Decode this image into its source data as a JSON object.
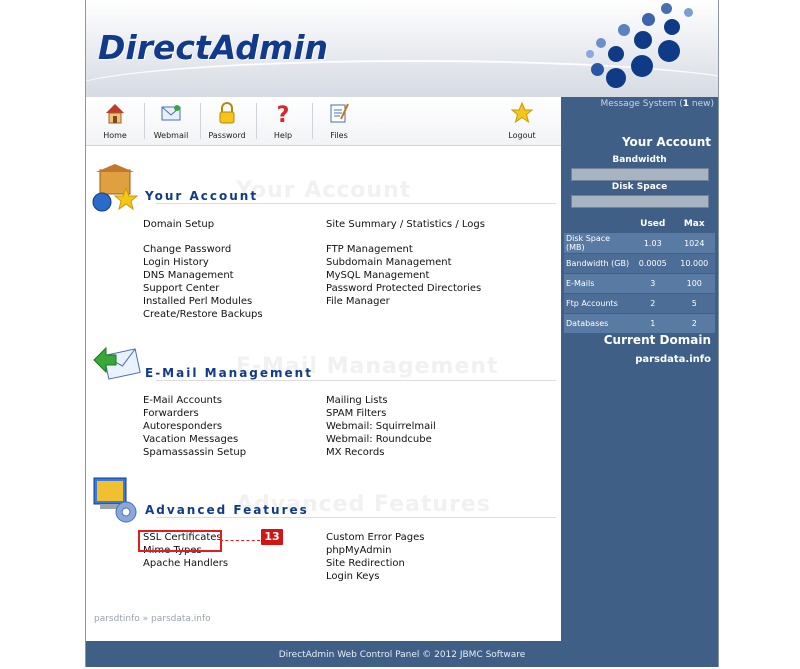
{
  "header": {
    "logo_text": "DirectAdmin"
  },
  "toolbar": {
    "items": [
      {
        "label": "Home",
        "icon": "home-icon"
      },
      {
        "label": "Webmail",
        "icon": "webmail-icon"
      },
      {
        "label": "Password",
        "icon": "lock-icon"
      },
      {
        "label": "Help",
        "icon": "question-icon"
      },
      {
        "label": "Files",
        "icon": "files-icon"
      },
      {
        "label": "Logout",
        "icon": "star-icon"
      }
    ]
  },
  "sidebar": {
    "message_prefix": "Message System (",
    "message_count": "1",
    "message_suffix": " new)",
    "your_account_title": "Your Account",
    "bandwidth_label": "Bandwidth",
    "diskspace_label": "Disk Space",
    "stats_headers": {
      "used": "Used",
      "max": "Max"
    },
    "stats": [
      {
        "name": "Disk Space (MB)",
        "used": "1.03",
        "max": "1024"
      },
      {
        "name": "Bandwidth (GB)",
        "used": "0.0005",
        "max": "10.000"
      },
      {
        "name": "E-Mails",
        "used": "3",
        "max": "100"
      },
      {
        "name": "Ftp Accounts",
        "used": "2",
        "max": "5"
      },
      {
        "name": "Databases",
        "used": "1",
        "max": "2"
      }
    ],
    "current_domain_title": "Current Domain",
    "current_domain": "parsdata.info"
  },
  "sections": {
    "account": {
      "title": "Your Account",
      "ghost": "Your Account",
      "left": [
        "Domain Setup",
        "",
        "Change Password",
        "Login History",
        "DNS Management",
        "Support Center",
        "Installed Perl Modules",
        "Create/Restore Backups"
      ],
      "right": [
        "Site Summary / Statistics / Logs",
        "",
        "FTP Management",
        "Subdomain Management",
        "MySQL Management",
        "Password Protected Directories",
        "File Manager"
      ]
    },
    "email": {
      "title": "E-Mail Management",
      "ghost": "E-Mail Management",
      "left": [
        "E-Mail Accounts",
        "Forwarders",
        "Autoresponders",
        "Vacation Messages",
        "Spamassassin Setup"
      ],
      "right": [
        "Mailing Lists",
        "SPAM Filters",
        "Webmail: Squirrelmail",
        "Webmail: Roundcube",
        "MX Records"
      ]
    },
    "advanced": {
      "title": "Advanced Features",
      "ghost": "Advanced Features",
      "left": [
        "SSL Certificates",
        "Mime Types",
        "Apache Handlers"
      ],
      "right": [
        "Custom Error Pages",
        "phpMyAdmin",
        "Site Redirection",
        "Login Keys"
      ]
    }
  },
  "breadcrumb": {
    "user": "parsdtinfo",
    "sep": "»",
    "domain": "parsdata.info"
  },
  "annotation": {
    "number": "13"
  },
  "footer": {
    "text": "DirectAdmin Web Control Panel © 2012 JBMC Software"
  },
  "colors": {
    "accent": "#123a8c",
    "sidebar": "#3f5f86",
    "annotation": "#e41c1c"
  }
}
